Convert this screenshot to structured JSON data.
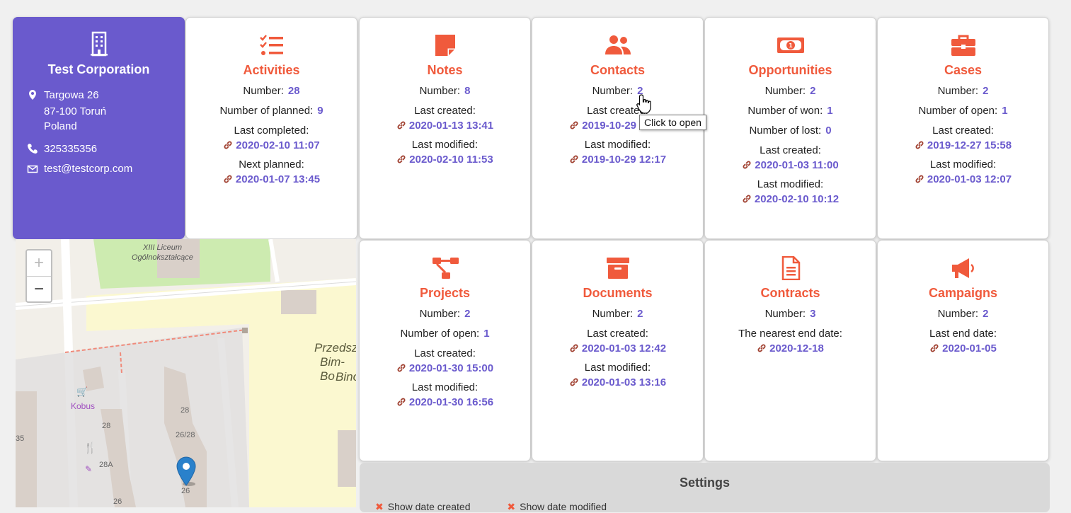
{
  "company": {
    "name": "Test Corporation",
    "address": [
      "Targowa 26",
      "87-100 Toruń",
      "Poland"
    ],
    "phone": "325335356",
    "email": "test@testcorp.com"
  },
  "cards": {
    "activities": {
      "title": "Activities",
      "number_label": "Number:",
      "number": "28",
      "planned_label": "Number of planned:",
      "planned": "9",
      "last_completed_label": "Last completed:",
      "last_completed": "2020-02-10 11:07",
      "next_planned_label": "Next planned:",
      "next_planned": "2020-01-07 13:45"
    },
    "notes": {
      "title": "Notes",
      "number_label": "Number:",
      "number": "8",
      "last_created_label": "Last created:",
      "last_created": "2020-01-13 13:41",
      "last_modified_label": "Last modified:",
      "last_modified": "2020-02-10 11:53"
    },
    "contacts": {
      "title": "Contacts",
      "number_label": "Number:",
      "number": "2",
      "last_created_label": "Last created:",
      "last_created": "2019-10-29 11:58",
      "last_modified_label": "Last modified:",
      "last_modified": "2019-10-29 12:17"
    },
    "opportunities": {
      "title": "Opportunities",
      "number_label": "Number:",
      "number": "2",
      "won_label": "Number of won:",
      "won": "1",
      "lost_label": "Number of lost:",
      "lost": "0",
      "last_created_label": "Last created:",
      "last_created": "2020-01-03 11:00",
      "last_modified_label": "Last modified:",
      "last_modified": "2020-02-10 10:12"
    },
    "cases": {
      "title": "Cases",
      "number_label": "Number:",
      "number": "2",
      "open_label": "Number of open:",
      "open": "1",
      "last_created_label": "Last created:",
      "last_created": "2019-12-27 15:58",
      "last_modified_label": "Last modified:",
      "last_modified": "2020-01-03 12:07"
    },
    "projects": {
      "title": "Projects",
      "number_label": "Number:",
      "number": "2",
      "open_label": "Number of open:",
      "open": "1",
      "last_created_label": "Last created:",
      "last_created": "2020-01-30 15:00",
      "last_modified_label": "Last modified:",
      "last_modified": "2020-01-30 16:56"
    },
    "documents": {
      "title": "Documents",
      "number_label": "Number:",
      "number": "2",
      "last_created_label": "Last created:",
      "last_created": "2020-01-03 12:42",
      "last_modified_label": "Last modified:",
      "last_modified": "2020-01-03 13:16"
    },
    "contracts": {
      "title": "Contracts",
      "number_label": "Number:",
      "number": "3",
      "end_label": "The nearest end date:",
      "end": "2020-12-18"
    },
    "campaigns": {
      "title": "Campaigns",
      "number_label": "Number:",
      "number": "2",
      "end_label": "Last end date:",
      "end": "2020-01-05"
    }
  },
  "map": {
    "labels": {
      "school_1": "XIII Liceum",
      "school_2": "Ogólnokształcące",
      "kinder_1": "Przedsz",
      "kinder_2": "Bim-Bo",
      "kinder_3": "Bino",
      "shop": "Kobus",
      "h28a": "28",
      "h2628": "26/28",
      "h28b": "28",
      "h28A": "28A",
      "h26": "26",
      "h26b": "26",
      "h35": "35"
    },
    "zoom_in": "+",
    "zoom_out": "−"
  },
  "settings": {
    "title": "Settings",
    "opt_created": "Show date created",
    "opt_modified": "Show date modified"
  },
  "tooltip": "Click to open",
  "colors": {
    "accent": "#6a5acd",
    "title": "#f05a3c"
  }
}
